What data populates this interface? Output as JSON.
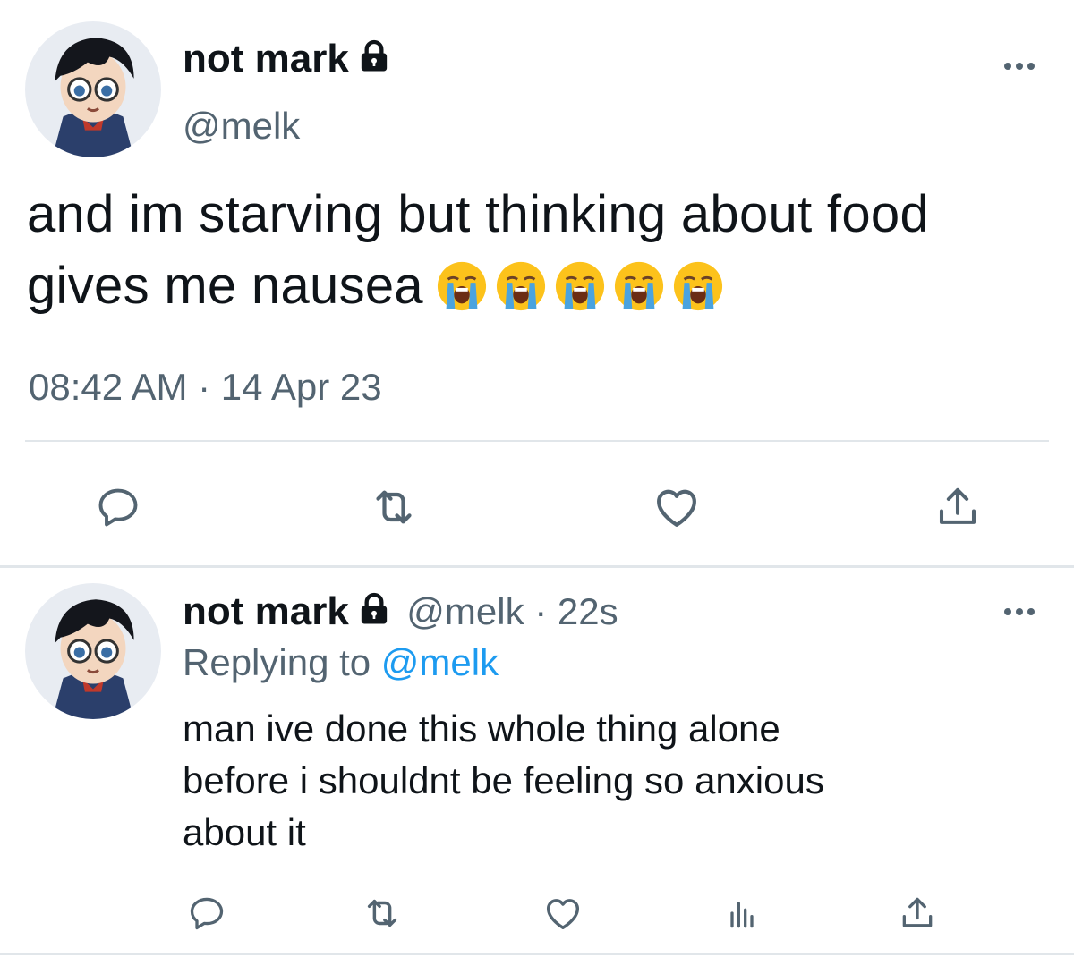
{
  "main_tweet": {
    "display_name": "not mark",
    "handle": "@melk",
    "text_line1": "and im starving but thinking about food",
    "text_line2": "gives me nausea",
    "emojis": [
      "loudly-crying-face",
      "loudly-crying-face",
      "loudly-crying-face",
      "loudly-crying-face",
      "loudly-crying-face"
    ],
    "timestamp": "08:42 AM · 14 Apr 23"
  },
  "reply_tweet": {
    "display_name": "not mark",
    "handle_time": "@melk · 22s",
    "replying_prefix": "Replying to",
    "replying_handle": "@melk",
    "text_line1": "man ive done this whole thing alone",
    "text_line2": "before i shouldnt be feeling so anxious",
    "text_line3": "about it"
  },
  "icons": [
    "lock-icon",
    "more-icon",
    "reply-icon",
    "retweet-icon",
    "like-icon",
    "share-icon",
    "analytics-icon"
  ],
  "colors": {
    "text": "#0f1419",
    "secondary": "#536471",
    "link": "#1d9bf0",
    "divider": "#e1e6ea"
  }
}
